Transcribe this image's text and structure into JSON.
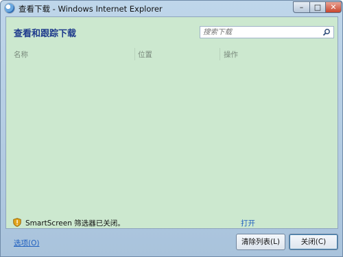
{
  "window": {
    "title": "查看下载 - Windows Internet Explorer",
    "controls": {
      "minimize": "–",
      "maximize": "□",
      "close": "✕"
    }
  },
  "header": {
    "title": "查看和跟踪下载",
    "search_placeholder": "搜索下载"
  },
  "columns": [
    "名称",
    "位置",
    "操作"
  ],
  "smartscreen": {
    "text": "SmartScreen 筛选器已关闭。",
    "action": "打开"
  },
  "footer": {
    "options_link": "选项(O)",
    "clear_button": "清除列表(L)",
    "close_button": "关闭(C)"
  },
  "colors": {
    "content_bg": "#cce8cf",
    "heading": "#1e3a8c",
    "link": "#1f5fbf"
  }
}
